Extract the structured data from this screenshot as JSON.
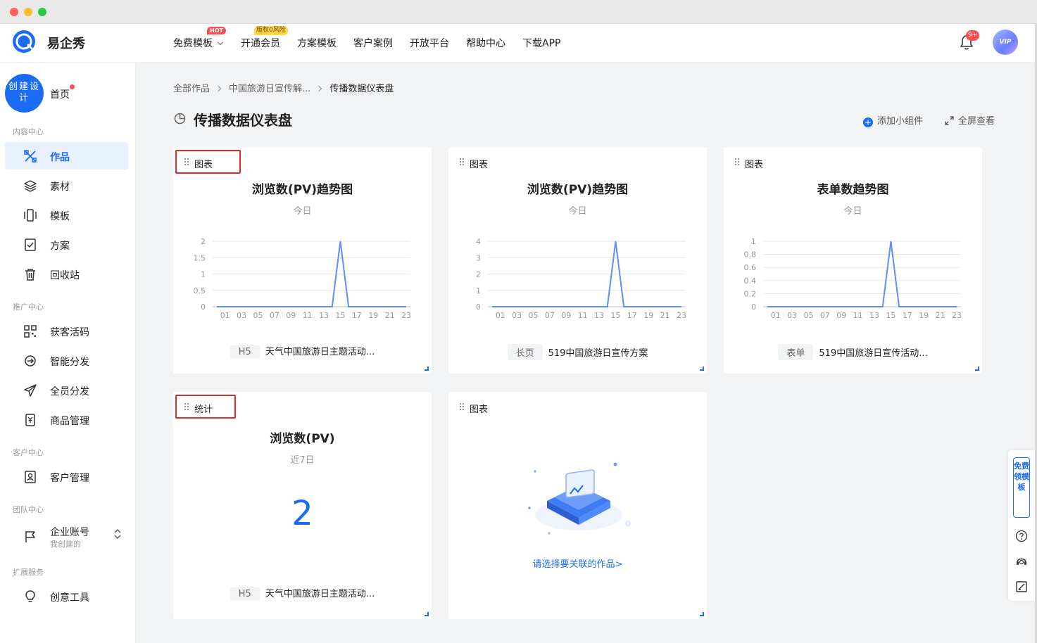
{
  "app": {
    "name": "易企秀"
  },
  "nav": {
    "items": [
      "免费模板",
      "开通会员",
      "方案模板",
      "客户案例",
      "开放平台",
      "帮助中心",
      "下载APP"
    ],
    "hot_badge": "HOT",
    "risk_badge": "版权0风险",
    "notifications": "9+",
    "avatar_label": "VIP"
  },
  "sidebar": {
    "create_button": "创建设计",
    "home": "首页",
    "sections": {
      "content": "内容中心",
      "promotion": "推广中心",
      "customer": "客户中心",
      "team": "团队中心",
      "extension": "扩展服务"
    },
    "items": {
      "works": "作品",
      "materials": "素材",
      "templates": "模板",
      "plans": "方案",
      "recycle": "回收站",
      "lead_code": "获客活码",
      "smart_distribute": "智能分发",
      "all_distribute": "全员分发",
      "product_manage": "商品管理",
      "customer_manage": "客户管理",
      "enterprise_account": "企业账号",
      "enterprise_sub": "我创建的",
      "creative_tools": "创意工具"
    }
  },
  "breadcrumb": [
    "全部作品",
    "中国旅游日宣传解...",
    "传播数据仪表盘"
  ],
  "page": {
    "title": "传播数据仪表盘",
    "add_widget": "添加小组件",
    "fullscreen": "全屏查看"
  },
  "cards": [
    {
      "kind": "图表",
      "title": "浏览数(PV)趋势图",
      "period": "今日",
      "tag": "H5",
      "work": "天气中国旅游日主题活动..."
    },
    {
      "kind": "图表",
      "title": "浏览数(PV)趋势图",
      "period": "今日",
      "tag": "长页",
      "work": "519中国旅游日宣传方案"
    },
    {
      "kind": "图表",
      "title": "表单数趋势图",
      "period": "今日",
      "tag": "表单",
      "work": "519中国旅游日宣传活动..."
    },
    {
      "kind": "统计",
      "title": "浏览数(PV)",
      "period": "近7日",
      "value": "2",
      "tag": "H5",
      "work": "天气中国旅游日主题活动..."
    },
    {
      "kind": "图表",
      "empty_link": "请选择要关联的作品>"
    }
  ],
  "chart_data": [
    {
      "type": "line",
      "x": [
        "00",
        "01",
        "02",
        "03",
        "04",
        "05",
        "06",
        "07",
        "08",
        "09",
        "10",
        "11",
        "12",
        "13",
        "14",
        "15",
        "16",
        "17",
        "18",
        "19",
        "20",
        "21",
        "22",
        "23"
      ],
      "tick_labels": [
        "01",
        "03",
        "05",
        "07",
        "09",
        "11",
        "13",
        "15",
        "17",
        "19",
        "21",
        "23"
      ],
      "y_ticks": [
        "0",
        "0.5",
        "1",
        "1.5",
        "2"
      ],
      "values": [
        0,
        0,
        0,
        0,
        0,
        0,
        0,
        0,
        0,
        0,
        0,
        0,
        0,
        0,
        0,
        2,
        0,
        0,
        0,
        0,
        0,
        0,
        0,
        0
      ],
      "ylim": [
        0,
        2
      ],
      "grid": true
    },
    {
      "type": "line",
      "x": [
        "00",
        "01",
        "02",
        "03",
        "04",
        "05",
        "06",
        "07",
        "08",
        "09",
        "10",
        "11",
        "12",
        "13",
        "14",
        "15",
        "16",
        "17",
        "18",
        "19",
        "20",
        "21",
        "22",
        "23"
      ],
      "tick_labels": [
        "01",
        "03",
        "05",
        "07",
        "09",
        "11",
        "13",
        "15",
        "17",
        "19",
        "21",
        "23"
      ],
      "y_ticks": [
        "0",
        "1",
        "2",
        "3",
        "4"
      ],
      "values": [
        0,
        0,
        0,
        0,
        0,
        0,
        0,
        0,
        0,
        0,
        0,
        0,
        0,
        0,
        0,
        4,
        0,
        0,
        0,
        0,
        0,
        0,
        0,
        0
      ],
      "ylim": [
        0,
        4
      ],
      "grid": true
    },
    {
      "type": "line",
      "x": [
        "00",
        "01",
        "02",
        "03",
        "04",
        "05",
        "06",
        "07",
        "08",
        "09",
        "10",
        "11",
        "12",
        "13",
        "14",
        "15",
        "16",
        "17",
        "18",
        "19",
        "20",
        "21",
        "22",
        "23"
      ],
      "tick_labels": [
        "01",
        "03",
        "05",
        "07",
        "09",
        "11",
        "13",
        "15",
        "17",
        "19",
        "21",
        "23"
      ],
      "y_ticks": [
        "0",
        "0.2",
        "0.4",
        "0.6",
        "0.8",
        "1"
      ],
      "values": [
        0,
        0,
        0,
        0,
        0,
        0,
        0,
        0,
        0,
        0,
        0,
        0,
        0,
        0,
        0,
        1,
        0,
        0,
        0,
        0,
        0,
        0,
        0,
        0
      ],
      "ylim": [
        0,
        1
      ],
      "grid": true
    }
  ],
  "float_panel": {
    "free_templates": "免费领模板"
  },
  "colors": {
    "accent": "#1a6cf5",
    "highlight": "#e02b2b",
    "line": "#5b8ff9"
  }
}
